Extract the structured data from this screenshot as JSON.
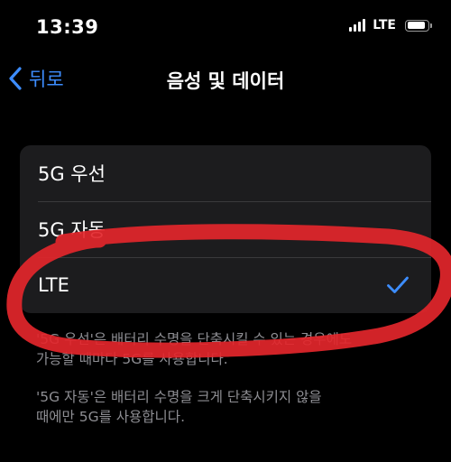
{
  "status_bar": {
    "time": "13:39",
    "network": "LTE",
    "battery_level": 0.9
  },
  "nav": {
    "back_label": "뒤로",
    "title": "음성 및 데이터"
  },
  "options": [
    {
      "label": "5G 우선",
      "selected": false
    },
    {
      "label": "5G 자동",
      "selected": false
    },
    {
      "label": "LTE",
      "selected": true
    }
  ],
  "footer": {
    "line1": "'5G 우선'은 배터리 수명을 단축시킬 수 있는 경우에도",
    "line2": "가능할 때마다 5G를 사용합니다.",
    "line3": "'5G 자동'은 배터리 수명을 크게 단축시키지 않을",
    "line4": "때에만 5G를 사용합니다."
  },
  "colors": {
    "accent": "#3d8dff",
    "annotation": "#e3262b",
    "cell_background": "#1c1c1e",
    "footer_text": "#8e8e93"
  },
  "icons": {
    "back": "chevron-left-icon",
    "checkmark": "checkmark-icon",
    "signal": "cellular-signal-icon",
    "battery": "battery-icon"
  }
}
